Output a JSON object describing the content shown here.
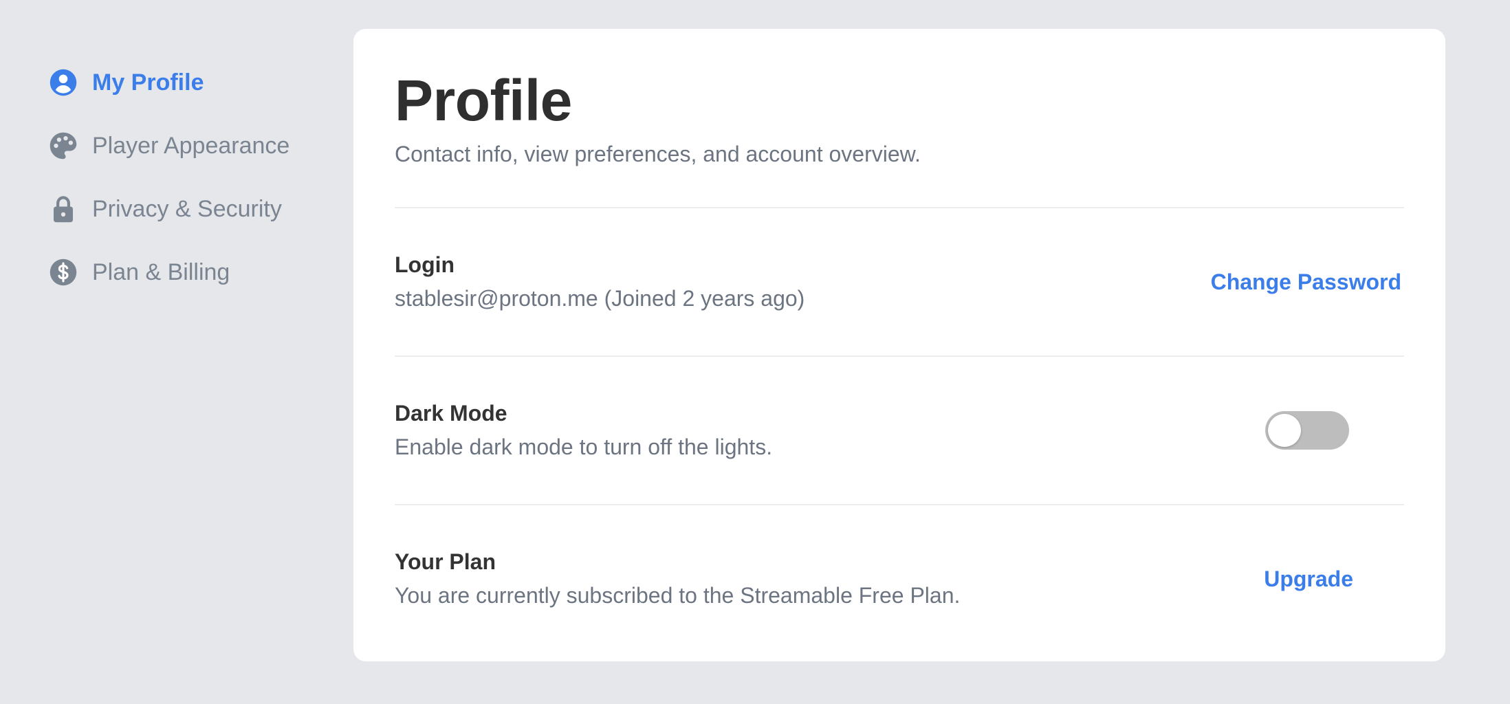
{
  "sidebar": {
    "items": [
      {
        "label": "My Profile",
        "icon": "user-circle-icon",
        "active": true
      },
      {
        "label": "Player Appearance",
        "icon": "palette-icon",
        "active": false
      },
      {
        "label": "Privacy & Security",
        "icon": "lock-icon",
        "active": false
      },
      {
        "label": "Plan & Billing",
        "icon": "dollar-circle-icon",
        "active": false
      }
    ]
  },
  "main": {
    "title": "Profile",
    "subtitle": "Contact info, view preferences, and account overview.",
    "sections": {
      "login": {
        "title": "Login",
        "description": "stablesir@proton.me (Joined 2 years ago)",
        "action_label": "Change Password"
      },
      "dark_mode": {
        "title": "Dark Mode",
        "description": "Enable dark mode to turn off the lights.",
        "enabled": false
      },
      "plan": {
        "title": "Your Plan",
        "description": "You are currently subscribed to the Streamable Free Plan.",
        "action_label": "Upgrade"
      }
    }
  },
  "colors": {
    "accent": "#3b7de9",
    "muted": "#7b8592",
    "background": "#e5e7eb",
    "toggle_off": "#bdbdbd"
  }
}
